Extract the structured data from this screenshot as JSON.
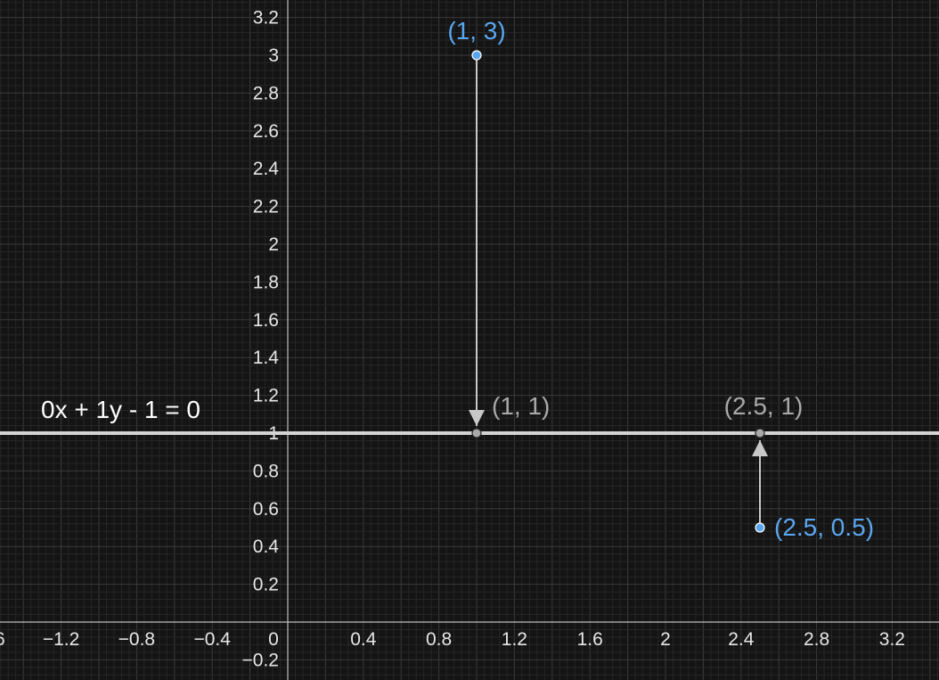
{
  "chart_data": {
    "type": "scatter",
    "xlim": [
      -0.76,
      3.4
    ],
    "ylim": [
      -0.3,
      3.3
    ],
    "grid": true,
    "minor_step": 0.04,
    "major_step": 0.2,
    "x_ticks": [
      {
        "value": -1.2,
        "label": "−1.2"
      },
      {
        "value": -0.8,
        "label": "−0.8"
      },
      {
        "value": -0.4,
        "label": "−0.4"
      },
      {
        "value": 0,
        "label": "0"
      },
      {
        "value": 0.4,
        "label": "0.4"
      },
      {
        "value": 0.8,
        "label": "0.8"
      },
      {
        "value": 1.2,
        "label": "1.2"
      },
      {
        "value": 1.6,
        "label": "1.6"
      },
      {
        "value": 2,
        "label": "2"
      },
      {
        "value": 2.4,
        "label": "2.4"
      },
      {
        "value": 2.8,
        "label": "2.8"
      },
      {
        "value": 3.2,
        "label": "3.2"
      }
    ],
    "y_ticks": [
      {
        "value": 3.2,
        "label": "3.2"
      },
      {
        "value": 3,
        "label": "3"
      },
      {
        "value": 2.8,
        "label": "2.8"
      },
      {
        "value": 2.6,
        "label": "2.6"
      },
      {
        "value": 2.4,
        "label": "2.4"
      },
      {
        "value": 2.2,
        "label": "2.2"
      },
      {
        "value": 2,
        "label": "2"
      },
      {
        "value": 1.8,
        "label": "1.8"
      },
      {
        "value": 1.6,
        "label": "1.6"
      },
      {
        "value": 1.4,
        "label": "1.4"
      },
      {
        "value": 1.2,
        "label": "1.2"
      },
      {
        "value": 1,
        "label": "1"
      },
      {
        "value": 0.8,
        "label": "0.8"
      },
      {
        "value": 0.6,
        "label": "0.6"
      },
      {
        "value": 0.4,
        "label": "0.4"
      },
      {
        "value": 0.2,
        "label": "0.2"
      },
      {
        "value": -0.2,
        "label": "−0.2"
      }
    ],
    "line": {
      "y": 1,
      "label": "0x + 1y - 1 = 0",
      "color": "#d4d4d4"
    },
    "points": [
      {
        "x": 1,
        "y": 3,
        "label": "(1, 3)",
        "color": "#5aa6ee"
      },
      {
        "x": 2.5,
        "y": 0.5,
        "label": "(2.5, 0.5)",
        "color": "#5aa6ee"
      },
      {
        "x": 1,
        "y": 1,
        "label": "(1, 1)",
        "color": "#a9a9a9"
      },
      {
        "x": 2.5,
        "y": 1,
        "label": "(2.5, 1)",
        "color": "#a9a9a9"
      }
    ],
    "arrows": [
      {
        "from": [
          1,
          3
        ],
        "to": [
          1,
          1
        ]
      },
      {
        "from": [
          2.5,
          0.5
        ],
        "to": [
          2.5,
          1
        ]
      }
    ],
    "colors": {
      "background": "#141414",
      "grid_minor": "#262626",
      "grid_major": "#3a3a3a",
      "axis": "#bdbdbd",
      "arrow": "#c8c8c8"
    }
  }
}
